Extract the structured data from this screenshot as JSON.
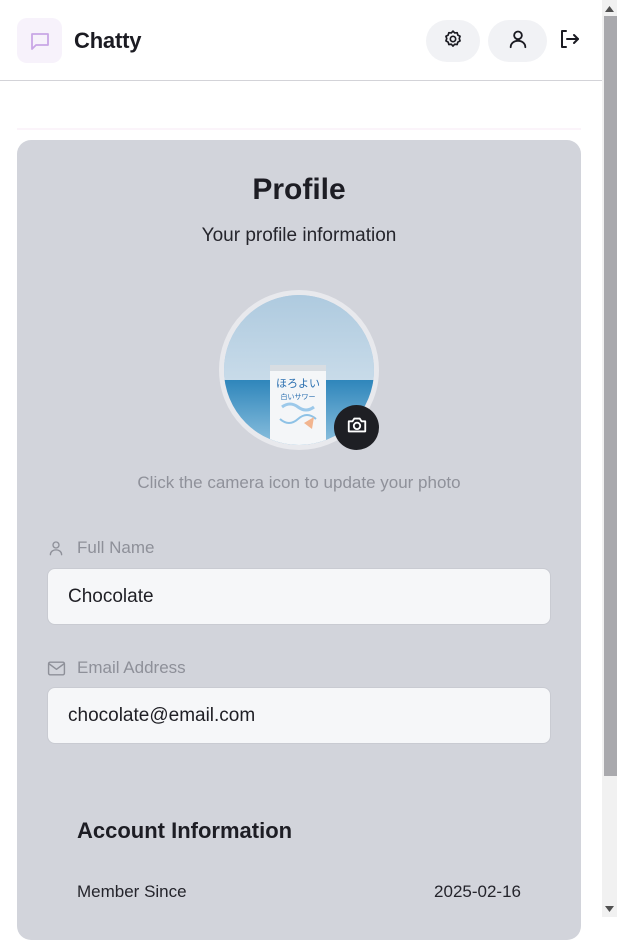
{
  "header": {
    "app_name": "Chatty",
    "icons": {
      "brand": "message-square-icon",
      "settings": "gear-icon",
      "profile": "user-icon",
      "logout": "logout-icon"
    }
  },
  "profile": {
    "title": "Profile",
    "subtitle": "Your profile information",
    "avatar_icon": "camera-icon",
    "hint": "Click the camera icon to update your photo",
    "fields": [
      {
        "label": "Full Name",
        "value": "Chocolate",
        "icon": "user-icon"
      },
      {
        "label": "Email Address",
        "value": "chocolate@email.com",
        "icon": "mail-icon"
      }
    ]
  },
  "account": {
    "title": "Account Information",
    "rows": [
      {
        "label": "Member Since",
        "value": "2025-02-16"
      }
    ]
  },
  "colors": {
    "card_bg": "#d2d4db",
    "brand_icon_bg": "#f7f2fb",
    "brand_icon_stroke": "#c9a6e6",
    "camera_bg": "#1e1f24"
  }
}
